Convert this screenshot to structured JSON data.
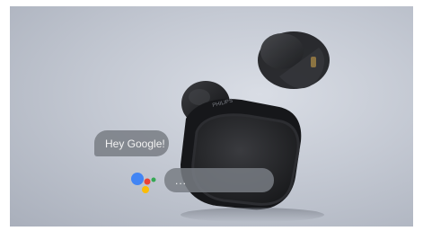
{
  "assistant": {
    "prompt_text": "Hey Google!",
    "reply_text": "...",
    "logo_colors": [
      "#4285F4",
      "#EA4335",
      "#FBBC05",
      "#34A853"
    ]
  },
  "product": {
    "brand_text": "PHILIPS"
  },
  "colors": {
    "background": "#c4c9d3",
    "earbud_body": "#1e1f22",
    "bubble": "#787c84"
  }
}
